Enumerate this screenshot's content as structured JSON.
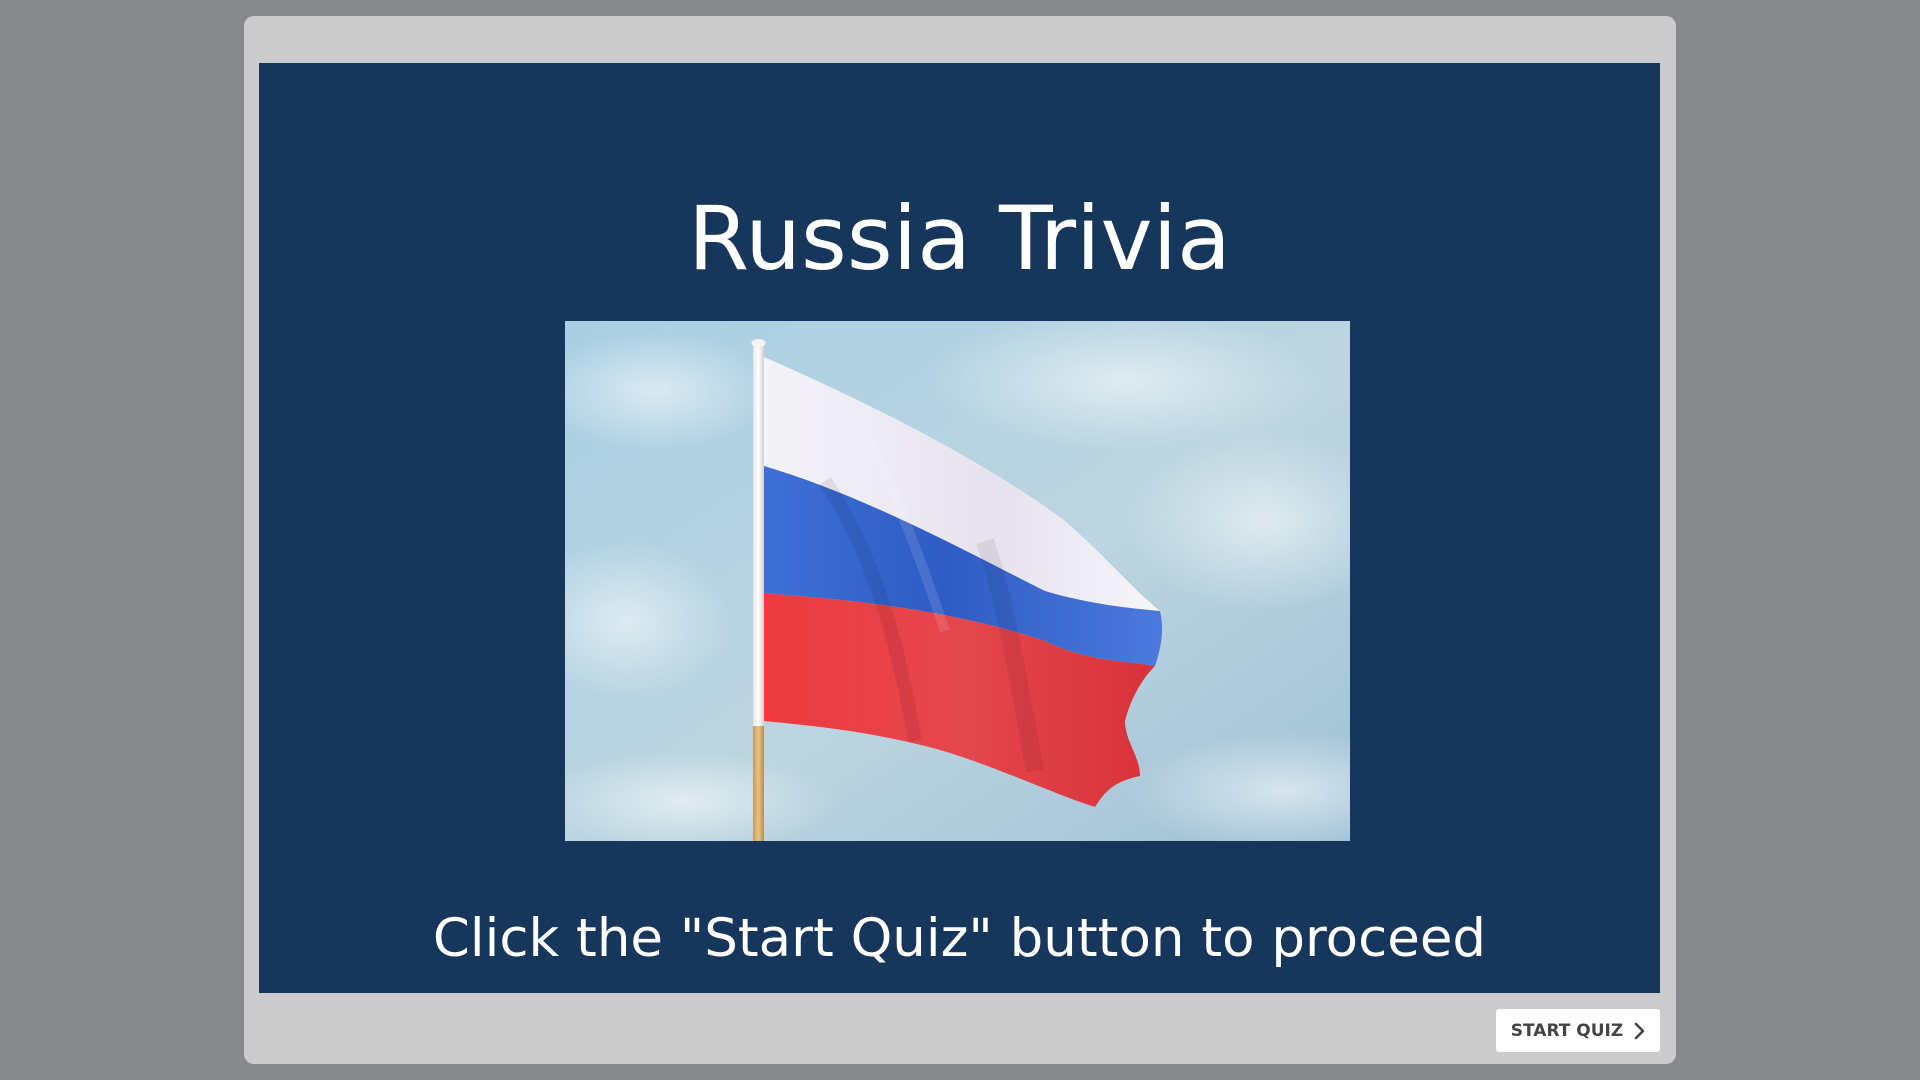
{
  "slide": {
    "title": "Russia Trivia",
    "image_alt": "Russian flag on a pole against a blue sky",
    "instruction": "Click the \"Start Quiz\" button to proceed"
  },
  "controls": {
    "start_label": "START QUIZ",
    "start_icon": "chevron-right-icon"
  },
  "colors": {
    "page_background": "#87898c",
    "player_frame": "#cbcbcb",
    "slide_background": "#16365c",
    "flag_white": "#f2f2f7",
    "flag_blue": "#3a6ad0",
    "flag_red": "#e4363d"
  }
}
